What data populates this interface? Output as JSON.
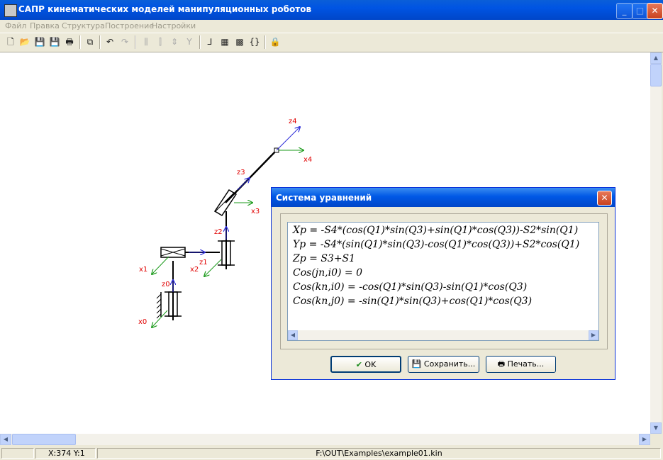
{
  "window": {
    "title": "САПР кинематических моделей манипуляционных роботов",
    "min_glyph": "_",
    "max_glyph": "□",
    "close_glyph": "✕"
  },
  "menu": [
    "Файл",
    "Правка",
    "Структура",
    "Построение",
    "Настройки"
  ],
  "toolbar": {
    "icons": [
      "new-icon",
      "open-icon",
      "save-icon",
      "save-as-icon",
      "print-icon",
      "copy-icon",
      "undo-icon",
      "redo-icon",
      "joint-revolute-icon",
      "joint-prismatic-icon",
      "joint-link-icon",
      "joint-gripper-icon",
      "axes-icon",
      "table-icon",
      "matrix-icon",
      "equations-icon",
      "lock-icon"
    ],
    "glyphs": {
      "new": "🗋",
      "open": "📂",
      "save": "💾",
      "save_as": "💾",
      "print": "🖶",
      "copy": "⧉",
      "undo": "↶",
      "redo": "↷",
      "j1": "⫼",
      "j2": "⫿",
      "j3": "⇕",
      "j4": "Y",
      "axes": "⅃",
      "table": "▦",
      "matrix": "▩",
      "equations": "{}",
      "lock": "🔒"
    }
  },
  "diagram": {
    "labels": {
      "x0": "x0",
      "z0": "z0",
      "x1": "x1",
      "z1": "z1",
      "x2": "x2",
      "z2": "z2",
      "x3": "x3",
      "z3": "z3",
      "x4": "x4",
      "z4": "z4"
    },
    "colors": {
      "z_axis": "#2a2ad8",
      "x_axis": "#1a9a1a",
      "label": "#e00000",
      "link": "#000000"
    }
  },
  "dialog": {
    "title": "Система уравнений",
    "close_glyph": "✕",
    "equations": [
      "Xp = -S4*(cos(Q1)*sin(Q3)+sin(Q1)*cos(Q3))-S2*sin(Q1)",
      "Yp = -S4*(sin(Q1)*sin(Q3)-cos(Q1)*cos(Q3))+S2*cos(Q1)",
      "Zp = S3+S1",
      "Cos(jn,i0) = 0",
      "Cos(kn,i0) = -cos(Q1)*sin(Q3)-sin(Q1)*cos(Q3)",
      "Cos(kn,j0) = -sin(Q1)*sin(Q3)+cos(Q1)*cos(Q3)"
    ],
    "buttons": {
      "ok": "OK",
      "ok_icon": "✔",
      "save": "Сохранить...",
      "save_icon": "💾",
      "print": "Печать...",
      "print_icon": "🖶"
    }
  },
  "scroll": {
    "up": "▲",
    "down": "▼",
    "left": "◀",
    "right": "▶"
  },
  "status": {
    "coords": "X:374   Y:1",
    "file": "F:\\OUT\\Examples\\example01.kin"
  }
}
